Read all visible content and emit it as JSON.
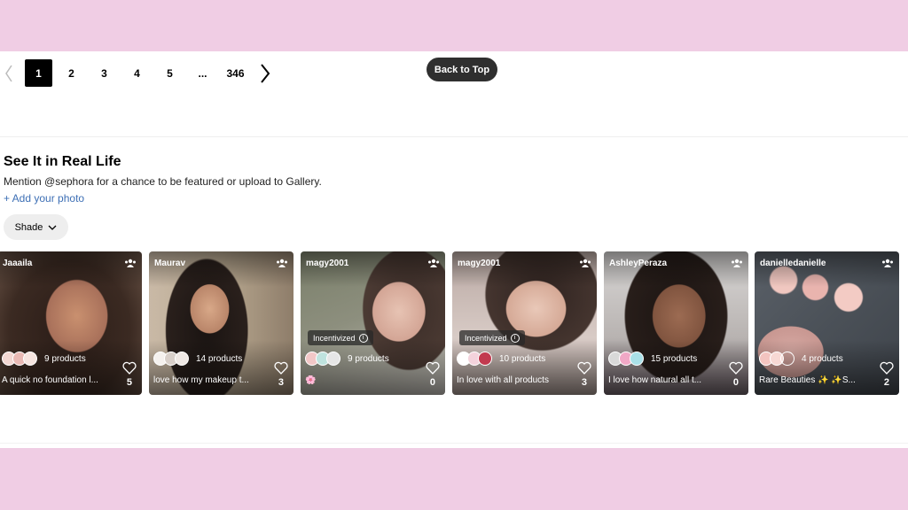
{
  "pagination": {
    "prev_icon": "chevron-left-icon",
    "next_icon": "chevron-right-icon",
    "pages": [
      "1",
      "2",
      "3",
      "4",
      "5",
      "...",
      "346"
    ],
    "current": "1"
  },
  "back_to_top": "Back to Top",
  "gallery": {
    "title": "See It in Real Life",
    "subtitle": "Mention @sephora for a chance to be featured or upload to Gallery.",
    "add_photo": "+ Add your photo",
    "filter_label": "Shade"
  },
  "cards": [
    {
      "user": "Jaaaila",
      "products": "9 products",
      "caption": "A quick no foundation l...",
      "likes": "5",
      "incentivized": ""
    },
    {
      "user": "Maurav",
      "products": "14 products",
      "caption": "love how my makeup t...",
      "likes": "3",
      "incentivized": ""
    },
    {
      "user": "magy2001",
      "products": "9 products",
      "caption": "🌸",
      "likes": "0",
      "incentivized": "Incentivized"
    },
    {
      "user": "magy2001",
      "products": "10 products",
      "caption": "In love with all products",
      "likes": "3",
      "incentivized": "Incentivized"
    },
    {
      "user": "AshleyPeraza",
      "products": "15 products",
      "caption": "I love how natural all t...",
      "likes": "0",
      "incentivized": ""
    },
    {
      "user": "danielledanielle",
      "products": "4 products",
      "caption": "Rare Beauties ✨ ✨S...",
      "likes": "2",
      "incentivized": ""
    }
  ],
  "colors": {
    "accent_link": "#3d6fb5",
    "page_bg": "#f0cde4",
    "active_page": "#000000"
  }
}
